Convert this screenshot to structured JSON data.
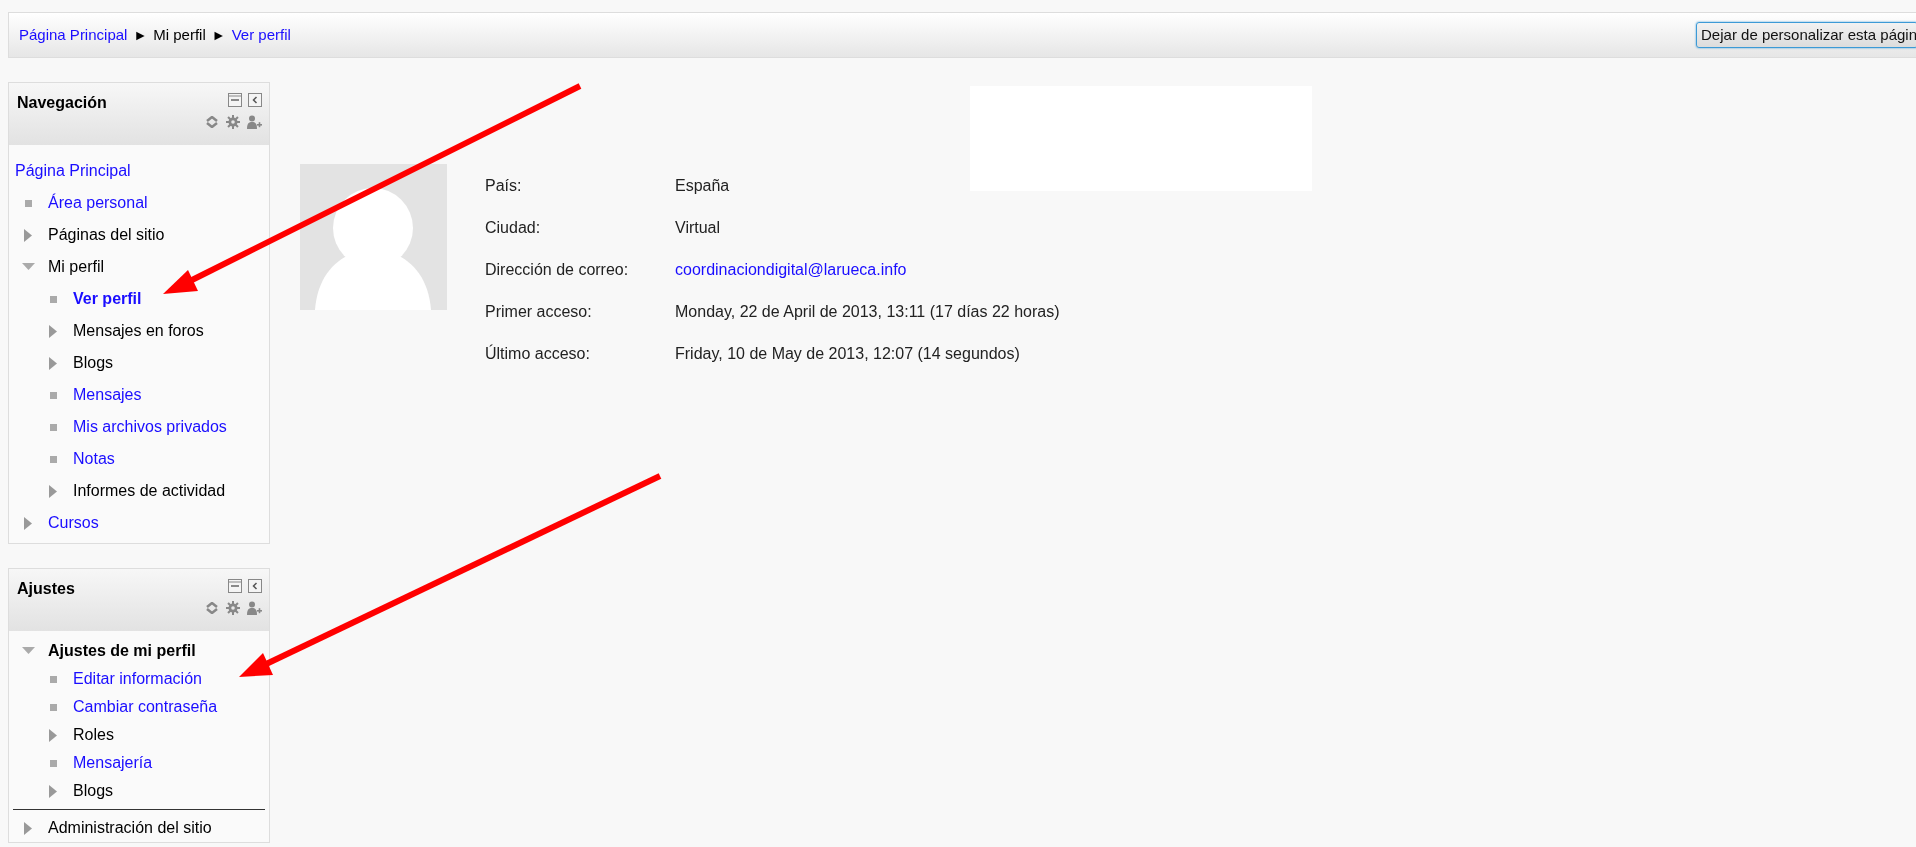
{
  "breadcrumb": [
    {
      "text": "Página Principal",
      "link": true
    },
    {
      "text": "Mi perfil",
      "link": false
    },
    {
      "text": "Ver perfil",
      "link": true
    }
  ],
  "breadcrumb_separator": "►",
  "customize_button": "Dejar de personalizar esta págin",
  "navigation": {
    "title": "Navegación",
    "items": [
      {
        "text": "Página Principal",
        "kind": "root",
        "link": true,
        "bold": false,
        "children": [
          {
            "text": "Área personal",
            "kind": "leaf",
            "link": true,
            "bold": false
          },
          {
            "text": "Páginas del sitio",
            "kind": "branch",
            "expanded": false,
            "link": false,
            "bold": false
          },
          {
            "text": "Mi perfil",
            "kind": "branch",
            "expanded": true,
            "link": false,
            "bold": false,
            "children": [
              {
                "text": "Ver perfil",
                "kind": "leaf",
                "link": true,
                "bold": true
              },
              {
                "text": "Mensajes en foros",
                "kind": "branch",
                "expanded": false,
                "link": false,
                "bold": false
              },
              {
                "text": "Blogs",
                "kind": "branch",
                "expanded": false,
                "link": false,
                "bold": false
              },
              {
                "text": "Mensajes",
                "kind": "leaf",
                "link": true,
                "bold": false
              },
              {
                "text": "Mis archivos privados",
                "kind": "leaf",
                "link": true,
                "bold": false
              },
              {
                "text": "Notas",
                "kind": "leaf",
                "link": true,
                "bold": false
              },
              {
                "text": "Informes de actividad",
                "kind": "branch",
                "expanded": false,
                "link": false,
                "bold": false
              }
            ]
          },
          {
            "text": "Cursos",
            "kind": "branch",
            "expanded": false,
            "link": true,
            "bold": false
          }
        ]
      }
    ]
  },
  "settings": {
    "title": "Ajustes",
    "groups": [
      [
        {
          "text": "Ajustes de mi perfil",
          "kind": "branch",
          "expanded": true,
          "link": false,
          "bold": true,
          "children": [
            {
              "text": "Editar información",
              "kind": "leaf",
              "link": true,
              "bold": false
            },
            {
              "text": "Cambiar contraseña",
              "kind": "leaf",
              "link": true,
              "bold": false
            },
            {
              "text": "Roles",
              "kind": "branch",
              "expanded": false,
              "link": false,
              "bold": false
            },
            {
              "text": "Mensajería",
              "kind": "leaf",
              "link": true,
              "bold": false
            },
            {
              "text": "Blogs",
              "kind": "branch",
              "expanded": false,
              "link": false,
              "bold": false
            }
          ]
        }
      ],
      [
        {
          "text": "Administración del sitio",
          "kind": "branch",
          "expanded": false,
          "link": false,
          "bold": false
        }
      ]
    ]
  },
  "profile": {
    "fields": [
      {
        "label": "País:",
        "value": "España",
        "link": false
      },
      {
        "label": "Ciudad:",
        "value": "Virtual",
        "link": false
      },
      {
        "label": "Dirección de correo:",
        "value": "coordinaciondigital@larueca.info",
        "link": true
      },
      {
        "label": "Primer acceso:",
        "value": "Monday, 22 de April de 2013, 13:11  (17 días 22 horas)",
        "link": false
      },
      {
        "label": "Último acceso:",
        "value": "Friday, 10 de May de 2013, 12:07  (14 segundos)",
        "link": false
      }
    ]
  }
}
